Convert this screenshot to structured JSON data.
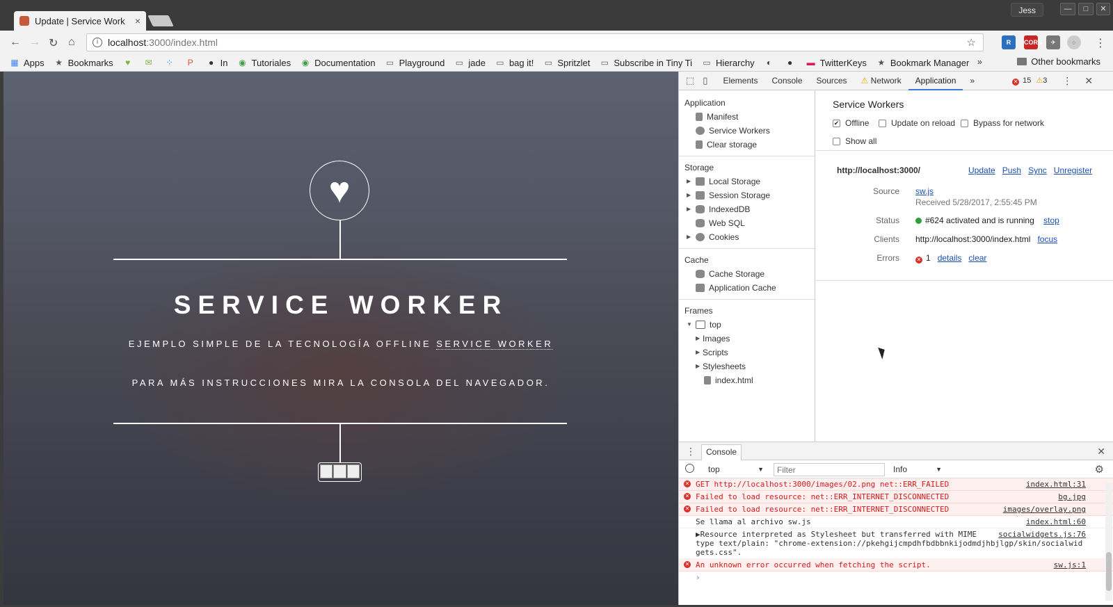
{
  "browser": {
    "tab_title": "Update | Service Work",
    "user": "Jess",
    "url_host": "localhost",
    "url_path": ":3000/index.html"
  },
  "bookmarks": [
    {
      "label": "Apps",
      "icon": "apps-grid-icon"
    },
    {
      "label": "Bookmarks",
      "icon": "star-icon"
    },
    {
      "label": "",
      "icon": "heart-bookmark-icon"
    },
    {
      "label": "",
      "icon": "chat-bookmark-icon"
    },
    {
      "label": "",
      "icon": "dots-bookmark-icon"
    },
    {
      "label": "",
      "icon": "producthunt-icon"
    },
    {
      "label": "In",
      "icon": "github-icon"
    },
    {
      "label": "Tutoriales",
      "icon": "globe-icon"
    },
    {
      "label": "Documentation",
      "icon": "globe-icon"
    },
    {
      "label": "Playground",
      "icon": "page-icon"
    },
    {
      "label": "jade",
      "icon": "page-icon"
    },
    {
      "label": "bag it!",
      "icon": "page-icon"
    },
    {
      "label": "Spritzlet",
      "icon": "page-icon"
    },
    {
      "label": "Subscribe in Tiny Ti",
      "icon": "page-icon"
    },
    {
      "label": "Hierarchy",
      "icon": "page-icon"
    },
    {
      "label": "",
      "icon": "eye-off-icon"
    },
    {
      "label": "",
      "icon": "github-icon"
    },
    {
      "label": "TwitterKeys",
      "icon": "twitter-keys-icon"
    },
    {
      "label": "Bookmark Manager",
      "icon": "star-icon"
    }
  ],
  "bookmarks_more": "»",
  "other_bookmarks": "Other bookmarks",
  "page": {
    "title": "SERVICE WORKER",
    "subtitle_prefix": "EJEMPLO SIMPLE DE LA TECNOLOGÍA OFFLINE",
    "subtitle_link": "SERVICE WORKER",
    "instructions": "PARA MÁS INSTRUCCIONES MIRA LA CONSOLA DEL NAVEGADOR.",
    "heart": "♥"
  },
  "devtools": {
    "tabs": [
      "Elements",
      "Console",
      "Sources",
      "Network",
      "Application"
    ],
    "active_tab": "Application",
    "more": "»",
    "error_count": "15",
    "warning_count": "3",
    "sidebar": {
      "application": {
        "title": "Application",
        "items": [
          "Manifest",
          "Service Workers",
          "Clear storage"
        ]
      },
      "storage": {
        "title": "Storage",
        "items": [
          "Local Storage",
          "Session Storage",
          "IndexedDB",
          "Web SQL",
          "Cookies"
        ]
      },
      "cache": {
        "title": "Cache",
        "items": [
          "Cache Storage",
          "Application Cache"
        ]
      },
      "frames": {
        "title": "Frames",
        "top": "top",
        "children": [
          "Images",
          "Scripts",
          "Stylesheets"
        ],
        "file": "index.html"
      }
    },
    "service_workers": {
      "title": "Service Workers",
      "offline_label": "Offline",
      "offline_checked": true,
      "update_on_reload_label": "Update on reload",
      "bypass_label": "Bypass for network",
      "show_all_label": "Show all",
      "scope": "http://localhost:3000/",
      "actions": [
        "Update",
        "Push",
        "Sync",
        "Unregister"
      ],
      "source_label": "Source",
      "source_file": "sw.js",
      "received": "Received 5/28/2017, 2:55:45 PM",
      "status_label": "Status",
      "status_text": "#624 activated and is running",
      "status_action": "stop",
      "status_color": "#2e9e3e",
      "clients_label": "Clients",
      "clients_url": "http://localhost:3000/index.html",
      "clients_action": "focus",
      "errors_label": "Errors",
      "errors_count": "1",
      "errors_details": "details",
      "errors_clear": "clear"
    },
    "console": {
      "drawer_tab": "Console",
      "context": "top",
      "filter_placeholder": "Filter",
      "level": "Info",
      "messages": [
        {
          "type": "error",
          "text": "GET http://localhost:3000/images/02.png net::ERR_FAILED",
          "source": "index.html:31"
        },
        {
          "type": "error",
          "text": "Failed to load resource: net::ERR_INTERNET_DISCONNECTED",
          "source": "bg.jpg"
        },
        {
          "type": "error",
          "text": "Failed to load resource: net::ERR_INTERNET_DISCONNECTED",
          "source": "images/overlay.png"
        },
        {
          "type": "log",
          "text": "Se llama al archivo sw.js",
          "source": "index.html:60"
        },
        {
          "type": "log",
          "text": "▶Resource interpreted as Stylesheet but transferred with MIME",
          "text2": "type text/plain: \"chrome-extension://pkehgijcmpdhfbdbbnkijodmdjhbjlgp/skin/socialwid",
          "text3": "gets.css\".",
          "source": "socialwidgets.js:76"
        },
        {
          "type": "error",
          "text": "An unknown error occurred when fetching the script.",
          "source": "sw.js:1"
        }
      ],
      "prompt": "›"
    },
    "colors": {
      "accent": "#3879d9",
      "error": "#d93025",
      "warning": "#f2a600"
    }
  }
}
